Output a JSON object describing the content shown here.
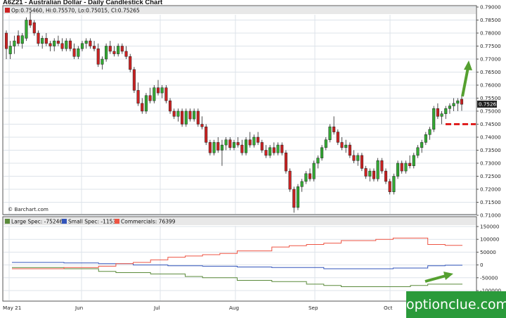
{
  "header": {
    "title": "A6Z21 - Australian Dollar - Daily Candlestick Chart",
    "ohlc": "Op:0.75460, Hi:0.75570, Lo:0.75015, Cl:0.75265",
    "price_badge": "0.75265",
    "source": "© Barchart.com"
  },
  "legend": {
    "large": "Large Spec: -75246",
    "small": "Small Spec: -1153",
    "comm": "Commercials: 76399"
  },
  "x_ticks": [
    "May 21",
    "Jun",
    "Jul",
    "Aug",
    "Sep",
    "Oct"
  ],
  "price_ticks": [
    "0.79000",
    "0.78500",
    "0.78000",
    "0.77500",
    "0.77000",
    "0.76500",
    "0.76000",
    "0.75500",
    "0.75000",
    "0.74500",
    "0.74000",
    "0.73500",
    "0.73000",
    "0.72500",
    "0.72000",
    "0.71500",
    "0.71000"
  ],
  "cot_ticks": [
    "150000",
    "100000",
    "50000",
    "0",
    "-50000",
    "-100000"
  ],
  "watermark": "optionclue.com",
  "colors": {
    "up": "#33aa33",
    "down": "#cc2222",
    "large": "#5a8a3a",
    "small": "#3355bb",
    "comm": "#ee5544",
    "accent": "#55a030",
    "level": "#e02020",
    "logo": "#2a9a3a"
  },
  "chart_data": [
    {
      "type": "candlestick",
      "title": "A6Z21 - Australian Dollar - Daily Candlestick Chart",
      "x_range": [
        "May 21",
        "Oct"
      ],
      "ylim": [
        0.71,
        0.79
      ],
      "series": [
        {
          "name": "A6Z21",
          "ohlc": [
            [
              0.78,
              0.781,
              0.77,
              0.774
            ],
            [
              0.772,
              0.777,
              0.77,
              0.775
            ],
            [
              0.775,
              0.779,
              0.772,
              0.777
            ],
            [
              0.779,
              0.781,
              0.775,
              0.776
            ],
            [
              0.776,
              0.78,
              0.774,
              0.779
            ],
            [
              0.778,
              0.786,
              0.777,
              0.785
            ],
            [
              0.785,
              0.788,
              0.782,
              0.783
            ],
            [
              0.784,
              0.785,
              0.779,
              0.78
            ],
            [
              0.78,
              0.781,
              0.775,
              0.776
            ],
            [
              0.776,
              0.779,
              0.774,
              0.778
            ],
            [
              0.778,
              0.78,
              0.775,
              0.776
            ],
            [
              0.776,
              0.777,
              0.773,
              0.775
            ],
            [
              0.775,
              0.778,
              0.773,
              0.777
            ],
            [
              0.777,
              0.779,
              0.775,
              0.776
            ],
            [
              0.776,
              0.778,
              0.773,
              0.774
            ],
            [
              0.774,
              0.778,
              0.773,
              0.777
            ],
            [
              0.777,
              0.778,
              0.773,
              0.774
            ],
            [
              0.774,
              0.776,
              0.77,
              0.771
            ],
            [
              0.771,
              0.775,
              0.77,
              0.774
            ],
            [
              0.774,
              0.777,
              0.773,
              0.776
            ],
            [
              0.776,
              0.778,
              0.774,
              0.777
            ],
            [
              0.777,
              0.778,
              0.774,
              0.775
            ],
            [
              0.775,
              0.777,
              0.773,
              0.774
            ],
            [
              0.774,
              0.776,
              0.767,
              0.768
            ],
            [
              0.768,
              0.771,
              0.766,
              0.77
            ],
            [
              0.77,
              0.776,
              0.769,
              0.775
            ],
            [
              0.775,
              0.777,
              0.772,
              0.773
            ],
            [
              0.773,
              0.775,
              0.771,
              0.772
            ],
            [
              0.772,
              0.776,
              0.771,
              0.775
            ],
            [
              0.775,
              0.776,
              0.772,
              0.773
            ],
            [
              0.773,
              0.775,
              0.77,
              0.771
            ],
            [
              0.771,
              0.772,
              0.765,
              0.766
            ],
            [
              0.766,
              0.767,
              0.757,
              0.758
            ],
            [
              0.758,
              0.761,
              0.752,
              0.753
            ],
            [
              0.753,
              0.755,
              0.749,
              0.75
            ],
            [
              0.75,
              0.757,
              0.749,
              0.756
            ],
            [
              0.756,
              0.759,
              0.753,
              0.754
            ],
            [
              0.754,
              0.76,
              0.753,
              0.759
            ],
            [
              0.759,
              0.762,
              0.756,
              0.757
            ],
            [
              0.757,
              0.76,
              0.755,
              0.759
            ],
            [
              0.759,
              0.76,
              0.753,
              0.754
            ],
            [
              0.754,
              0.755,
              0.749,
              0.75
            ],
            [
              0.75,
              0.751,
              0.747,
              0.748
            ],
            [
              0.748,
              0.751,
              0.746,
              0.75
            ],
            [
              0.75,
              0.751,
              0.744,
              0.745
            ],
            [
              0.745,
              0.751,
              0.744,
              0.75
            ],
            [
              0.75,
              0.751,
              0.746,
              0.747
            ],
            [
              0.747,
              0.751,
              0.746,
              0.75
            ],
            [
              0.75,
              0.751,
              0.744,
              0.745
            ],
            [
              0.745,
              0.748,
              0.743,
              0.744
            ],
            [
              0.744,
              0.745,
              0.737,
              0.738
            ],
            [
              0.738,
              0.739,
              0.733,
              0.734
            ],
            [
              0.734,
              0.739,
              0.733,
              0.738
            ],
            [
              0.738,
              0.74,
              0.734,
              0.735
            ],
            [
              0.735,
              0.739,
              0.729,
              0.737
            ],
            [
              0.737,
              0.74,
              0.735,
              0.739
            ],
            [
              0.739,
              0.74,
              0.735,
              0.736
            ],
            [
              0.736,
              0.739,
              0.735,
              0.738
            ],
            [
              0.738,
              0.74,
              0.736,
              0.737
            ],
            [
              0.737,
              0.739,
              0.733,
              0.734
            ],
            [
              0.734,
              0.74,
              0.733,
              0.739
            ],
            [
              0.739,
              0.742,
              0.736,
              0.737
            ],
            [
              0.737,
              0.741,
              0.736,
              0.74
            ],
            [
              0.74,
              0.742,
              0.737,
              0.738
            ],
            [
              0.738,
              0.739,
              0.734,
              0.735
            ],
            [
              0.735,
              0.737,
              0.732,
              0.733
            ],
            [
              0.733,
              0.737,
              0.732,
              0.736
            ],
            [
              0.736,
              0.738,
              0.733,
              0.734
            ],
            [
              0.734,
              0.738,
              0.733,
              0.737
            ],
            [
              0.737,
              0.738,
              0.733,
              0.734
            ],
            [
              0.734,
              0.735,
              0.726,
              0.727
            ],
            [
              0.727,
              0.728,
              0.719,
              0.72
            ],
            [
              0.72,
              0.721,
              0.711,
              0.713
            ],
            [
              0.713,
              0.722,
              0.712,
              0.721
            ],
            [
              0.721,
              0.724,
              0.719,
              0.723
            ],
            [
              0.723,
              0.727,
              0.722,
              0.726
            ],
            [
              0.726,
              0.728,
              0.723,
              0.724
            ],
            [
              0.724,
              0.731,
              0.723,
              0.73
            ],
            [
              0.73,
              0.733,
              0.728,
              0.732
            ],
            [
              0.732,
              0.737,
              0.731,
              0.736
            ],
            [
              0.736,
              0.74,
              0.735,
              0.739
            ],
            [
              0.739,
              0.745,
              0.738,
              0.744
            ],
            [
              0.744,
              0.748,
              0.741,
              0.742
            ],
            [
              0.742,
              0.743,
              0.737,
              0.738
            ],
            [
              0.738,
              0.74,
              0.735,
              0.736
            ],
            [
              0.736,
              0.739,
              0.734,
              0.737
            ],
            [
              0.737,
              0.738,
              0.732,
              0.733
            ],
            [
              0.733,
              0.735,
              0.73,
              0.731
            ],
            [
              0.731,
              0.734,
              0.729,
              0.733
            ],
            [
              0.733,
              0.734,
              0.727,
              0.728
            ],
            [
              0.728,
              0.729,
              0.724,
              0.725
            ],
            [
              0.725,
              0.728,
              0.723,
              0.727
            ],
            [
              0.727,
              0.728,
              0.723,
              0.724
            ],
            [
              0.724,
              0.732,
              0.723,
              0.731
            ],
            [
              0.731,
              0.732,
              0.726,
              0.727
            ],
            [
              0.727,
              0.728,
              0.722,
              0.723
            ],
            [
              0.723,
              0.724,
              0.718,
              0.719
            ],
            [
              0.719,
              0.726,
              0.718,
              0.725
            ],
            [
              0.725,
              0.731,
              0.724,
              0.73
            ],
            [
              0.73,
              0.731,
              0.726,
              0.727
            ],
            [
              0.727,
              0.731,
              0.726,
              0.73
            ],
            [
              0.73,
              0.733,
              0.728,
              0.729
            ],
            [
              0.729,
              0.734,
              0.728,
              0.733
            ],
            [
              0.733,
              0.737,
              0.732,
              0.736
            ],
            [
              0.736,
              0.739,
              0.734,
              0.738
            ],
            [
              0.738,
              0.742,
              0.737,
              0.741
            ],
            [
              0.741,
              0.744,
              0.739,
              0.743
            ],
            [
              0.743,
              0.752,
              0.742,
              0.751
            ],
            [
              0.751,
              0.753,
              0.747,
              0.748
            ],
            [
              0.748,
              0.75,
              0.745,
              0.749
            ],
            [
              0.749,
              0.752,
              0.747,
              0.751
            ],
            [
              0.751,
              0.753,
              0.749,
              0.752
            ],
            [
              0.752,
              0.755,
              0.75,
              0.753
            ],
            [
              0.753,
              0.755,
              0.75,
              0.754
            ],
            [
              0.7546,
              0.7557,
              0.75015,
              0.75265
            ]
          ]
        }
      ],
      "annotations": [
        {
          "type": "horizontal-level",
          "y": 0.7455
        },
        {
          "type": "arrow",
          "direction": "up"
        }
      ]
    },
    {
      "type": "line",
      "title": "",
      "ylim": [
        -100000,
        150000
      ],
      "series": [
        {
          "name": "Large Spec",
          "values": [
            -10000,
            -10000,
            -10000,
            -15000,
            -15000,
            -25000,
            -30000,
            -30000,
            -35000,
            -35000,
            -45000,
            -50000,
            -50000,
            -60000,
            -60000,
            -65000,
            -65000,
            -75000,
            -80000,
            -85000,
            -85000,
            -85000,
            -85000,
            -80000,
            -75000,
            -75000
          ]
        },
        {
          "name": "Small Spec",
          "values": [
            10000,
            10000,
            10000,
            8000,
            8000,
            5000,
            5000,
            0,
            0,
            -3000,
            -3000,
            -5000,
            -5000,
            -8000,
            -8000,
            -10000,
            -10000,
            -10000,
            -15000,
            -15000,
            -15000,
            -15000,
            -12000,
            -12000,
            -3000,
            -1153
          ]
        },
        {
          "name": "Commercials",
          "values": [
            -15000,
            -15000,
            -15000,
            -10000,
            -10000,
            -5000,
            5000,
            10000,
            20000,
            30000,
            35000,
            40000,
            45000,
            55000,
            55000,
            70000,
            75000,
            80000,
            85000,
            95000,
            95000,
            100000,
            105000,
            105000,
            80000,
            76399
          ]
        }
      ]
    }
  ]
}
